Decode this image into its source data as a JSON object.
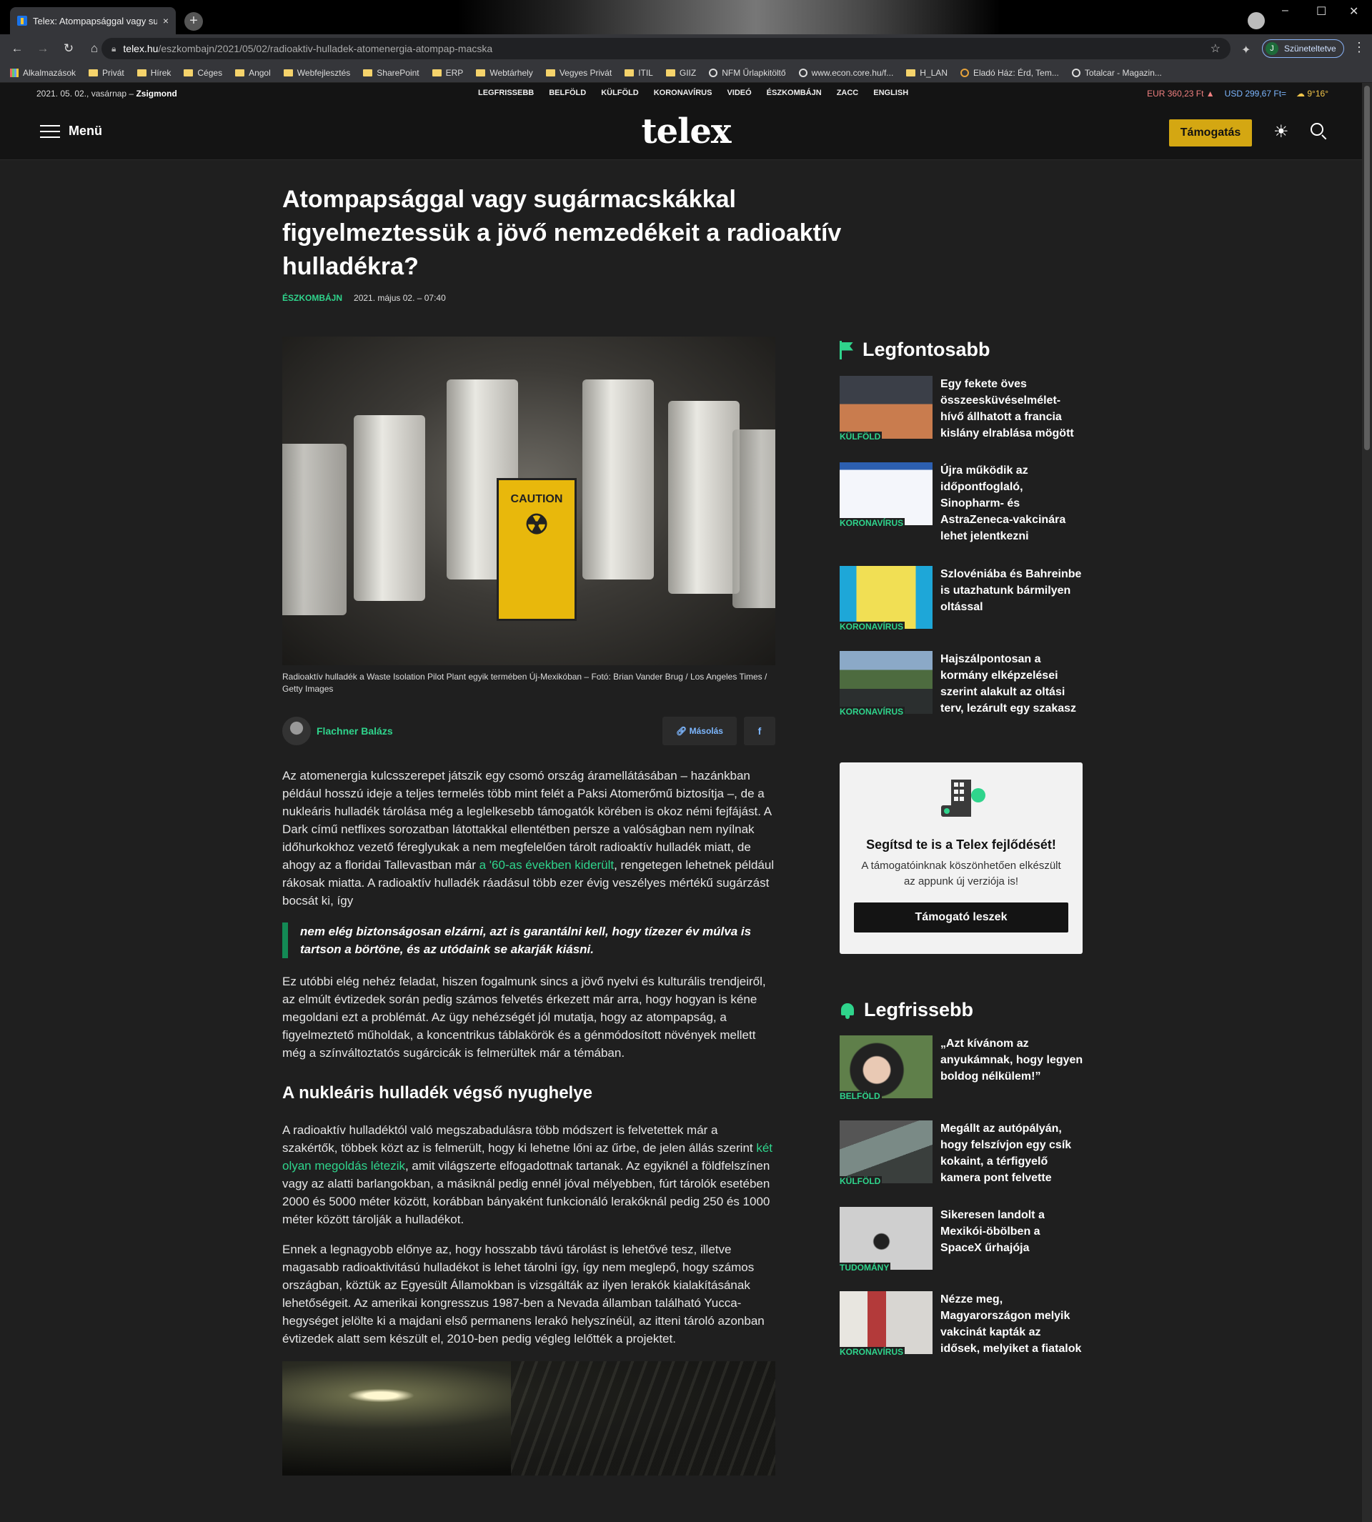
{
  "browser": {
    "tab_title": "Telex: Atompapsággal vagy sugá",
    "tab_close": "×",
    "new_tab": "+",
    "url_domain": "telex.hu",
    "url_path": "/eszkombajn/2021/05/02/radioaktiv-hulladek-atomenergia-atompap-macska",
    "profile_initial": "J",
    "profile_status": "Szüneteltetve",
    "bookmarks": [
      "Alkalmazások",
      "Privát",
      "Hírek",
      "Céges",
      "Angol",
      "Webfejlesztés",
      "SharePoint",
      "ERP",
      "Webtárhely",
      "Vegyes Privát",
      "ITIL",
      "GIIZ",
      "NFM Űrlapkitöltő",
      "www.econ.core.hu/f...",
      "H_LAN",
      "Eladó Ház: Érd, Tem...",
      "Totalcar - Magazin..."
    ]
  },
  "site": {
    "date": "2021. 05. 02., vasárnap –",
    "nameday": "Zsigmond",
    "topnav": [
      "LEGFRISSEBB",
      "BELFÖLD",
      "KÜLFÖLD",
      "KORONAVÍRUS",
      "VIDEÓ",
      "ÉSZKOMBÁJN",
      "ZACC",
      "ENGLISH"
    ],
    "eur": "EUR 360,23 Ft ▲",
    "usd": "USD 299,67 Ft=",
    "weather": "☁ 9°16°",
    "menu_label": "Menü",
    "logo": "telex",
    "support_label": "Támogatás"
  },
  "article": {
    "title": "Atompapsággal vagy sugármacskákkal figyelmeztessük a jövő nemzedékeit a radioaktív hulladékra?",
    "category": "ÉSZKOMBÁJN",
    "datetime": "2021. május 02. – 07:40",
    "image_sign": "CAUTION",
    "caption": "Radioaktív hulladék a Waste Isolation Pilot Plant egyik termében Új-Mexikóban – Fotó: Brian Vander Brug / Los Angeles Times / Getty Images",
    "author": "Flachner Balázs",
    "copy_label": "Másolás",
    "fb_label": "f",
    "p1_a": "Az atomenergia kulcsszerepet játszik egy csomó ország áramellátásában – hazánkban például hosszú ideje a teljes termelés több mint felét a Paksi Atomerőmű biztosítja –, de a nukleáris hulladék tárolása még a leglelkesebb támogatók körében is okoz némi fejfájást. A Dark című netflixes sorozatban látottakkal ellentétben persze a valóságban nem nyílnak időhurkokhoz vezető féreglyukak a nem megfelelően tárolt radioaktív hulladék miatt, de ahogy az a floridai Tallevastban már ",
    "p1_link": "a '60-as években kiderült",
    "p1_b": ", rengetegen lehetnek például rákosak miatta. A radioaktív hulladék ráadásul több ezer évig veszélyes mértékű sugárzást bocsát ki, így",
    "quote": "nem elég biztonságosan elzárni, azt is garantálni kell, hogy tízezer év múlva is tartson a börtöne, és az utódaink se akarják kiásni.",
    "p2": "Ez utóbbi elég nehéz feladat, hiszen fogalmunk sincs a jövő nyelvi és kulturális trendjeiről, az elmúlt évtizedek során pedig számos felvetés érkezett már arra, hogy hogyan is kéne megoldani ezt a problémát. Az ügy nehézségét jól mutatja, hogy az atompapság, a figyelmeztető műholdak, a koncentrikus táblakörök és a génmódosított növények mellett még a színváltoztatós sugárcicák is felmerültek már a témában.",
    "h2": "A nukleáris hulladék végső nyughelye",
    "p3_a": "A radioaktív hulladéktól való megszabadulásra több módszert is felvetettek már a szakértők, többek közt az is felmerült, hogy ki lehetne lőni az űrbe, de jelen állás szerint ",
    "p3_link": "két olyan megoldás létezik",
    "p3_b": ", amit világszerte elfogadottnak tartanak. Az egyiknél a földfelszínen vagy az alatti barlangokban, a másiknál pedig ennél jóval mélyebben, fúrt tárolók esetében 2000 és 5000 méter között, korábban bányaként funkcionáló lerakóknál pedig 250 és 1000 méter között tárolják a hulladékot.",
    "p4": "Ennek a legnagyobb előnye az, hogy hosszabb távú tárolást is lehetővé tesz, illetve magasabb radioaktivitású hulladékot is lehet tárolni így, így nem meglepő, hogy számos országban, köztük az Egyesült Államokban is vizsgálták az ilyen lerakók kialakításának lehetőségeit. Az amerikai kongresszus 1987-ben a Nevada államban található Yucca-hegységet jelölte ki a majdani első permanens lerakó helyszínéül, az itteni tároló azonban évtizedek alatt sem készült el, 2010-ben pedig végleg lelőtték a projektet."
  },
  "sidebar": {
    "top_title": "Legfontosabb",
    "top_items": [
      {
        "tag": "KÜLFÖLD",
        "text": "Egy fekete öves összeesküvéselmélet-hívő állhatott a francia kislány elrablása mögött"
      },
      {
        "tag": "KORONAVÍRUS",
        "text": "Újra működik az időpontfoglaló, Sinopharm- és AstraZeneca-vakcinára lehet jelentkezni"
      },
      {
        "tag": "KORONAVÍRUS",
        "text": "Szlovéniába és Bahreinbe is utazhatunk bármilyen oltással"
      },
      {
        "tag": "KORONAVÍRUS",
        "text": "Hajszálpontosan a kormány elképzelései szerint alakult az oltási terv, lezárult egy szakasz"
      }
    ],
    "support": {
      "heading": "Segítsd te is a Telex fejlődését!",
      "sub": "A támogatóinknak köszönhetően elkészült az appunk új verziója is!",
      "button": "Támogató leszek"
    },
    "fresh_title": "Legfrissebb",
    "fresh_items": [
      {
        "tag": "BELFÖLD",
        "text": "„Azt kívánom az anyukámnak, hogy legyen boldog nélkülem!”"
      },
      {
        "tag": "KÜLFÖLD",
        "text": "Megállt az autópályán, hogy felszívjon egy csík kokaint, a térfigyelő kamera pont felvette"
      },
      {
        "tag": "TUDOMÁNY",
        "text": "Sikeresen landolt a Mexikói-öbölben a SpaceX űrhajója"
      },
      {
        "tag": "KORONAVÍRUS",
        "text": "Nézze meg, Magyarországon melyik vakcinát kapták az idősek, melyiket a fiatalok"
      }
    ]
  }
}
